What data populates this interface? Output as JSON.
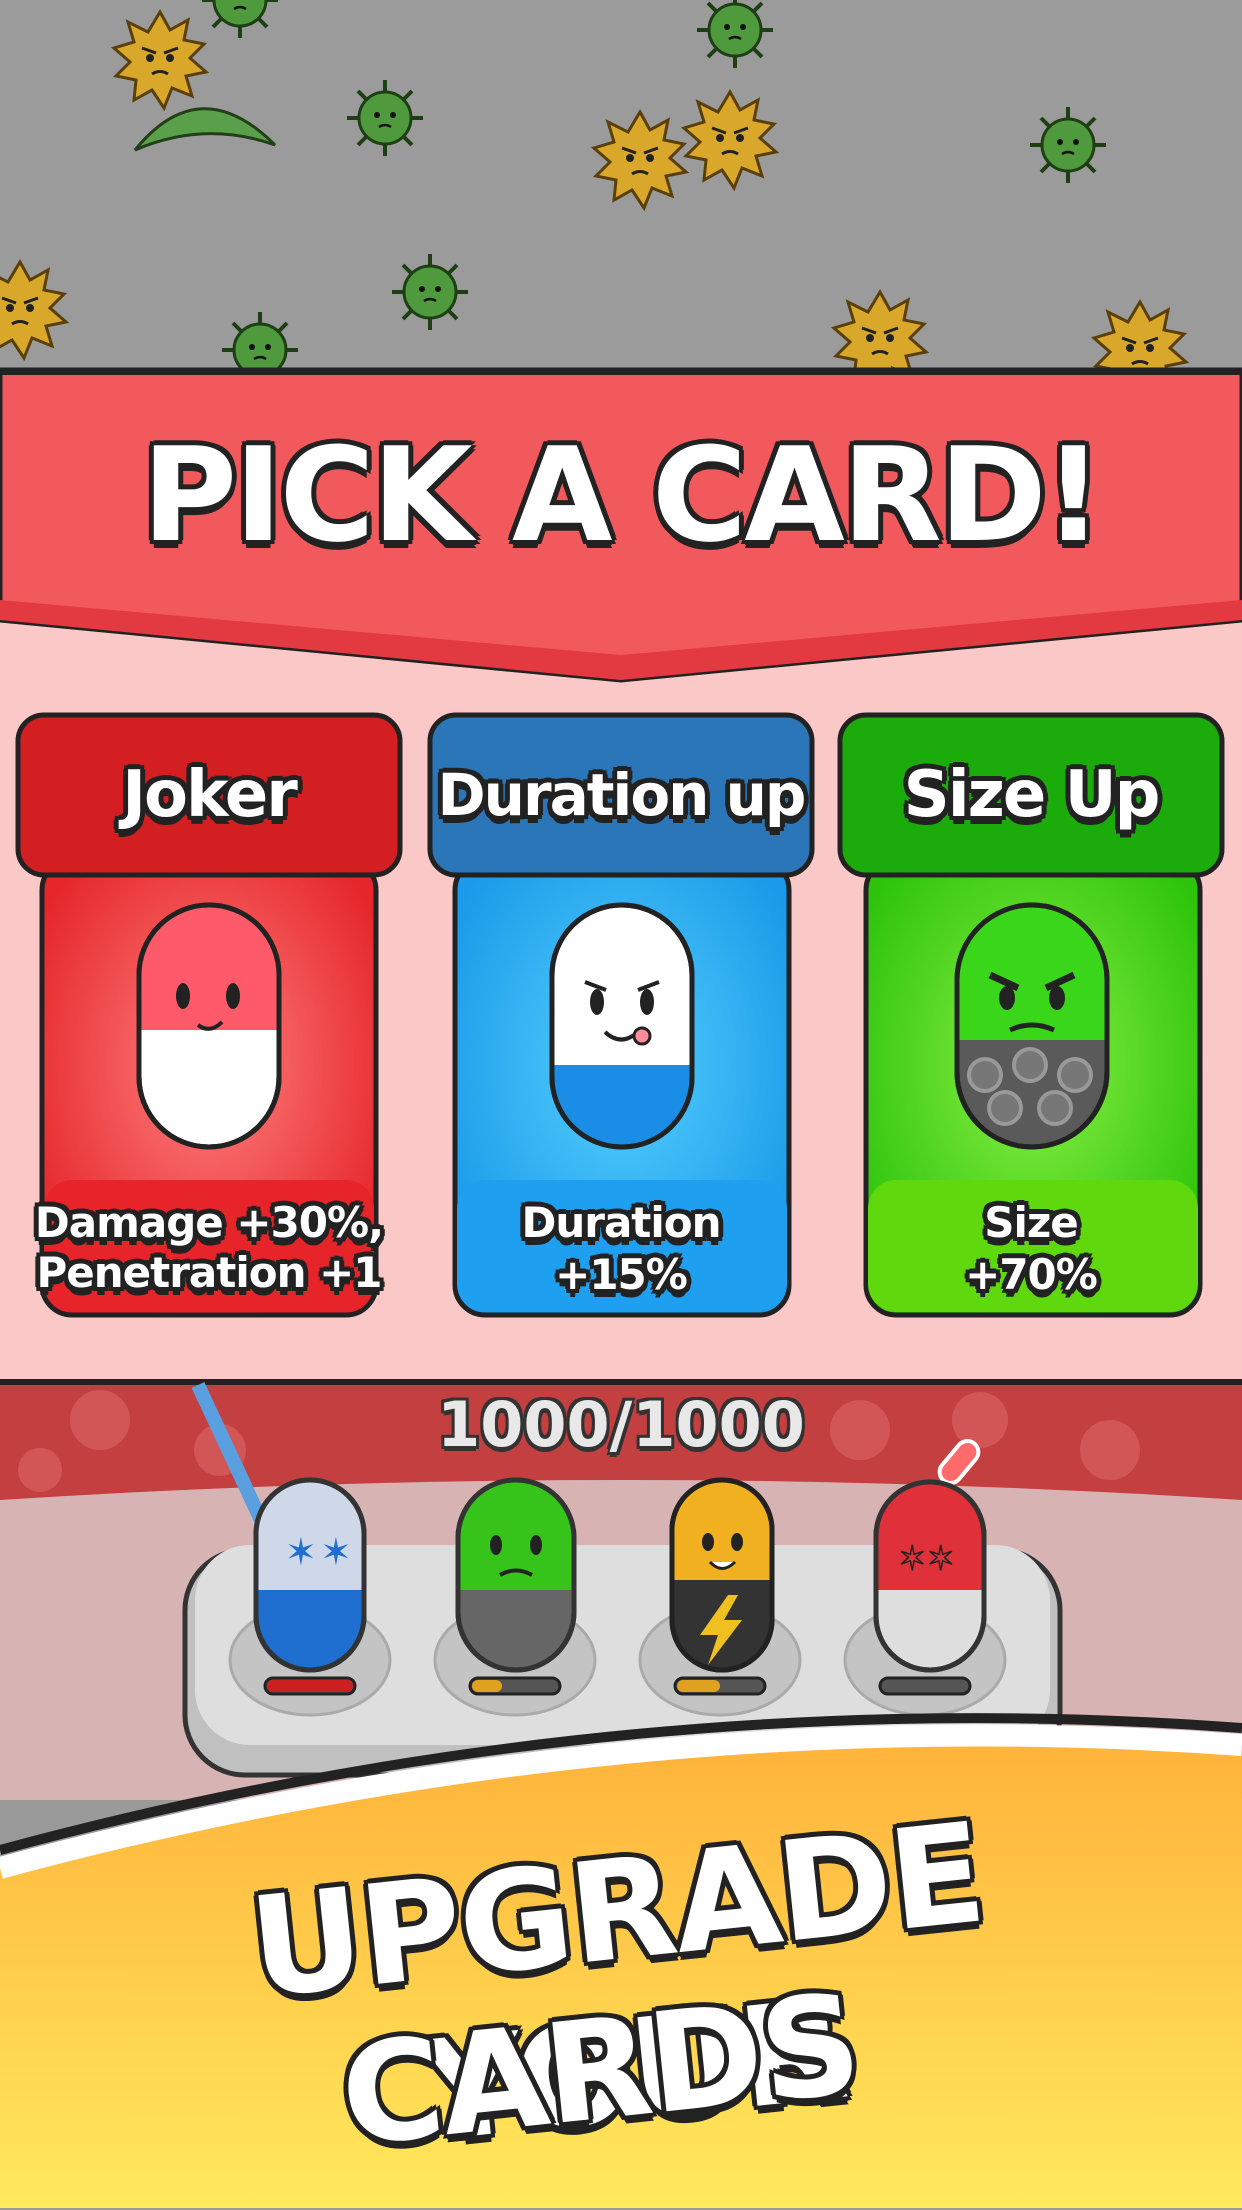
{
  "banner": {
    "title": "PICK A CARD!"
  },
  "cards": [
    {
      "title": "Joker",
      "desc_line1": "Damage +30%,",
      "desc_line2": "Penetration +1"
    },
    {
      "title": "Duration up",
      "desc_line1": "Duration",
      "desc_line2": "+15%"
    },
    {
      "title": "Size Up",
      "desc_line1": "Size",
      "desc_line2": "+70%"
    }
  ],
  "tray": {
    "count": "1000/1000",
    "slots": [
      {
        "name": "blue-star-pill",
        "level": 1.0,
        "bar_color": "#cc1f1f"
      },
      {
        "name": "green-armor-pill",
        "level": 0.35,
        "bar_color": "#e0a020"
      },
      {
        "name": "lightning-pill",
        "level": 0.5,
        "bar_color": "#e0a020"
      },
      {
        "name": "red-star-pill",
        "level": 0.0,
        "bar_color": "#666666"
      }
    ]
  },
  "promo": {
    "line1": "UPGRADE YOUR",
    "line2": "CARDS"
  },
  "colors": {
    "banner_red": "#f2595d",
    "joker_red": "#e8302f",
    "duration_blue": "#2a86d6",
    "size_green": "#22b50a",
    "promo_yellow": "#ffc83a"
  }
}
